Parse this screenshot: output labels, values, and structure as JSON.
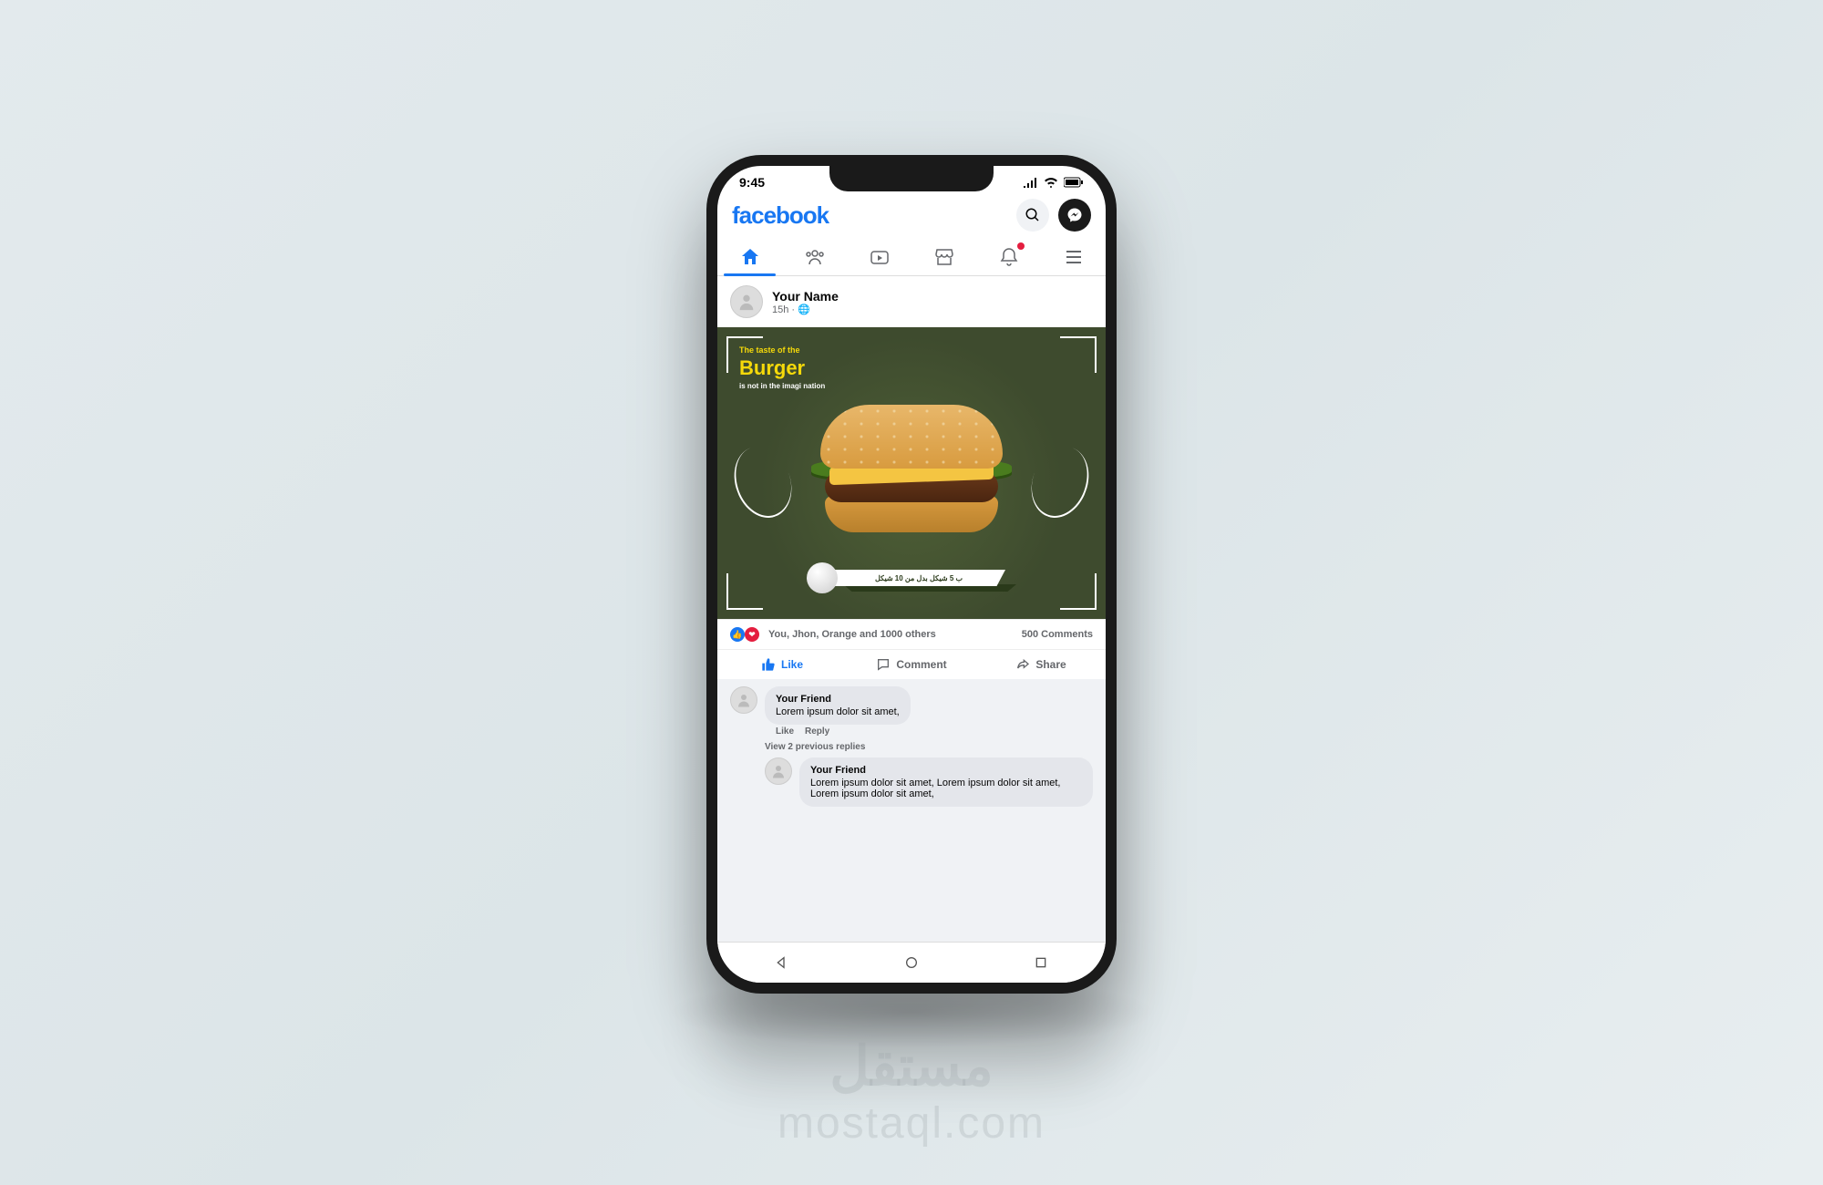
{
  "status": {
    "time": "9:45"
  },
  "header": {
    "logo": "facebook"
  },
  "post": {
    "author": "Your Name",
    "time": "15h · 🌐",
    "ad": {
      "line1": "The taste of the",
      "line2": "Burger",
      "line3": "is not in the imagi nation",
      "price": "ب 5 شيكل بدل من 10 شيكل"
    },
    "reactions_text": "You, Jhon, Orange and 1000 others",
    "comments_count": "500 Comments",
    "actions": {
      "like": "Like",
      "comment": "Comment",
      "share": "Share"
    }
  },
  "comments": {
    "c1": {
      "name": "Your Friend",
      "body": "Lorem ipsum dolor sit amet,"
    },
    "like": "Like",
    "reply": "Reply",
    "prev": "View 2 previous replies",
    "c2": {
      "name": "Your Friend",
      "body": "Lorem ipsum dolor sit amet, Lorem ipsum dolor sit amet, Lorem ipsum dolor sit amet,"
    }
  },
  "watermark": {
    "ar": "مستقل",
    "en": "mostaql.com"
  }
}
